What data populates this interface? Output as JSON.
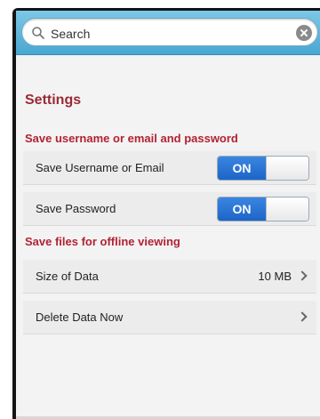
{
  "search": {
    "placeholder": "Search"
  },
  "page": {
    "title": "Settings"
  },
  "sections": [
    {
      "header": "Save username or email and password",
      "rows": [
        {
          "label": "Save Username or Email",
          "toggle": "ON"
        },
        {
          "label": "Save Password",
          "toggle": "ON"
        }
      ]
    },
    {
      "header": "Save files for offline viewing",
      "rows": [
        {
          "label": "Size of Data",
          "value": "10 MB",
          "icon": "chevron-right-icon"
        },
        {
          "label": "Delete Data Now",
          "icon": "chevron-right-icon"
        }
      ]
    }
  ],
  "colors": {
    "header_accent": "#b22234",
    "toggle_on": "#2a74d4",
    "search_bar": "#5fb6dd"
  }
}
